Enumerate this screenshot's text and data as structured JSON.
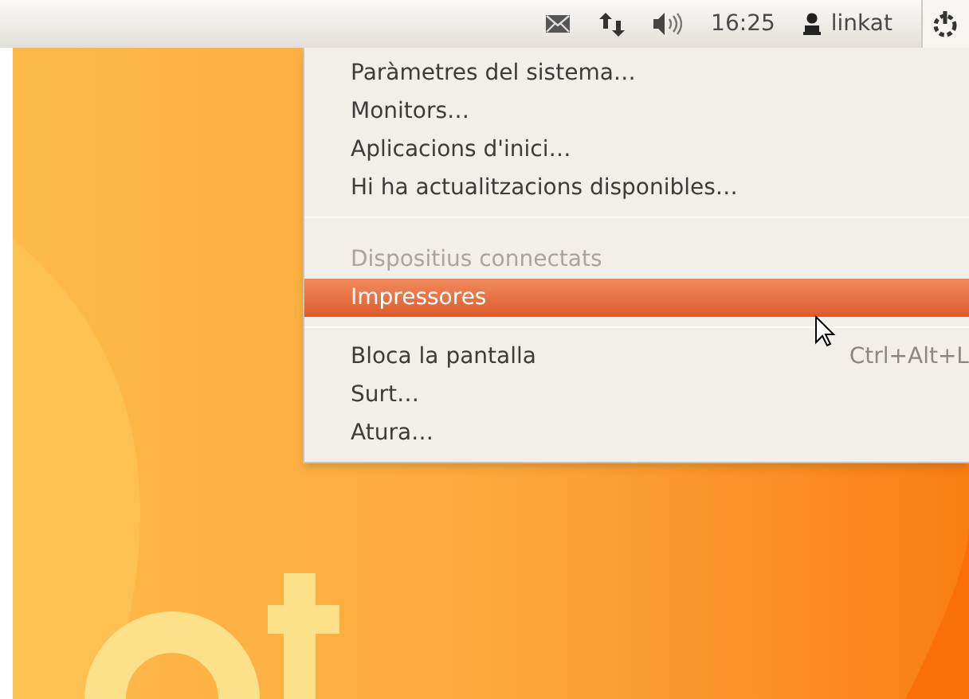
{
  "panel": {
    "clock": "16:25",
    "user": "linkat",
    "session_menu_open": true
  },
  "menu": {
    "items": [
      {
        "kind": "item",
        "label": "Paràmetres del sistema…",
        "selected": false,
        "disabled": false
      },
      {
        "kind": "item",
        "label": "Monitors…",
        "selected": false,
        "disabled": false
      },
      {
        "kind": "item",
        "label": "Aplicacions d'inici…",
        "selected": false,
        "disabled": false
      },
      {
        "kind": "item",
        "label": "Hi ha actualitzacions disponibles…",
        "selected": false,
        "disabled": false
      },
      {
        "kind": "separator"
      },
      {
        "kind": "item",
        "label": "Dispositius connectats",
        "selected": false,
        "disabled": true
      },
      {
        "kind": "item",
        "label": "Impressores",
        "selected": true,
        "disabled": false
      },
      {
        "kind": "separator"
      },
      {
        "kind": "item",
        "label": "Bloca la pantalla",
        "shortcut": "Ctrl+Alt+L",
        "selected": false,
        "disabled": false
      },
      {
        "kind": "item",
        "label": "Surt…",
        "selected": false,
        "disabled": false
      },
      {
        "kind": "item",
        "label": "Atura…",
        "selected": false,
        "disabled": false
      }
    ]
  }
}
